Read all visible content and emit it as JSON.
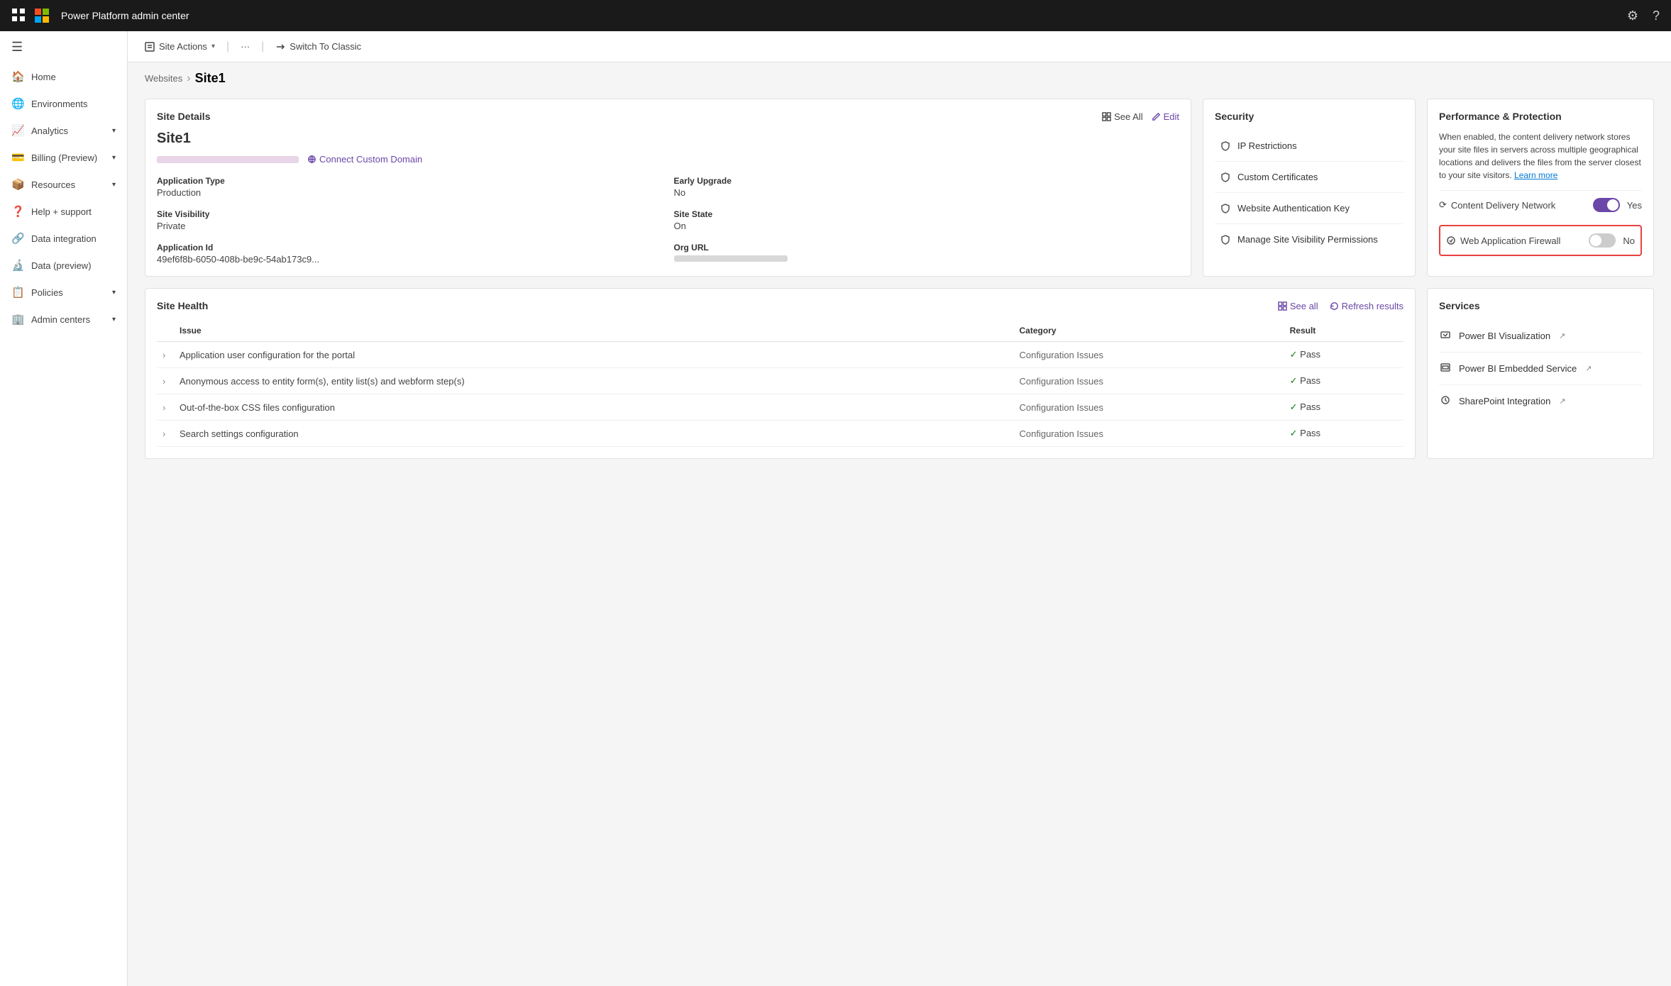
{
  "topbar": {
    "title": "Power Platform admin center",
    "settings_icon": "⚙",
    "help_icon": "?"
  },
  "sub_topbar": {
    "site_actions_label": "Site Actions",
    "more_label": "···",
    "switch_label": "Switch To Classic"
  },
  "breadcrumb": {
    "parent": "Websites",
    "current": "Site1"
  },
  "site_details": {
    "card_title": "Site Details",
    "see_all": "See All",
    "edit": "Edit",
    "site_name": "Site1",
    "connect_domain": "Connect Custom Domain",
    "fields": [
      {
        "label": "Application Type",
        "value": "Production"
      },
      {
        "label": "Early Upgrade",
        "value": "No"
      },
      {
        "label": "Site Visibility",
        "value": "Private"
      },
      {
        "label": "Site State",
        "value": "On"
      },
      {
        "label": "Application Id",
        "value": "49ef6f8b-6050-408b-be9c-54ab173c9..."
      },
      {
        "label": "Org URL",
        "value": ""
      }
    ]
  },
  "security": {
    "card_title": "Security",
    "items": [
      {
        "icon": "🔍",
        "label": "IP Restrictions"
      },
      {
        "icon": "🔒",
        "label": "Custom Certificates"
      },
      {
        "icon": "🔑",
        "label": "Website Authentication Key"
      },
      {
        "icon": "🔒",
        "label": "Manage Site Visibility Permissions"
      }
    ]
  },
  "performance": {
    "card_title": "Performance & Protection",
    "description": "When enabled, the content delivery network stores your site files in servers across multiple geographical locations and delivers the files from the server closest to your site visitors.",
    "learn_more": "Learn more",
    "cdn_label": "Content Delivery Network",
    "cdn_value": "Yes",
    "cdn_on": true,
    "waf_label": "Web Application Firewall",
    "waf_value": "No",
    "waf_on": false
  },
  "site_health": {
    "card_title": "Site Health",
    "see_all": "See all",
    "refresh": "Refresh results",
    "columns": [
      "Issue",
      "Category",
      "Result"
    ],
    "rows": [
      {
        "issue": "Application user configuration for the portal",
        "category": "Configuration Issues",
        "result": "Pass"
      },
      {
        "issue": "Anonymous access to entity form(s), entity list(s) and webform step(s)",
        "category": "Configuration Issues",
        "result": "Pass"
      },
      {
        "issue": "Out-of-the-box CSS files configuration",
        "category": "Configuration Issues",
        "result": "Pass"
      },
      {
        "issue": "Search settings configuration",
        "category": "Configuration Issues",
        "result": "Pass"
      }
    ]
  },
  "services": {
    "card_title": "Services",
    "items": [
      {
        "icon": "📊",
        "label": "Power BI Visualization"
      },
      {
        "icon": "🖼",
        "label": "Power BI Embedded Service"
      },
      {
        "icon": "⚙",
        "label": "SharePoint Integration"
      }
    ]
  },
  "sidebar": {
    "menu_icon": "☰",
    "items": [
      {
        "icon": "🏠",
        "label": "Home",
        "has_chevron": false
      },
      {
        "icon": "🌐",
        "label": "Environments",
        "has_chevron": false
      },
      {
        "icon": "📈",
        "label": "Analytics",
        "has_chevron": true
      },
      {
        "icon": "💳",
        "label": "Billing (Preview)",
        "has_chevron": true
      },
      {
        "icon": "📦",
        "label": "Resources",
        "has_chevron": true
      },
      {
        "icon": "❓",
        "label": "Help + support",
        "has_chevron": false
      },
      {
        "icon": "🔗",
        "label": "Data integration",
        "has_chevron": false
      },
      {
        "icon": "🔬",
        "label": "Data (preview)",
        "has_chevron": false
      },
      {
        "icon": "📋",
        "label": "Policies",
        "has_chevron": true
      },
      {
        "icon": "🏢",
        "label": "Admin centers",
        "has_chevron": true
      }
    ]
  }
}
